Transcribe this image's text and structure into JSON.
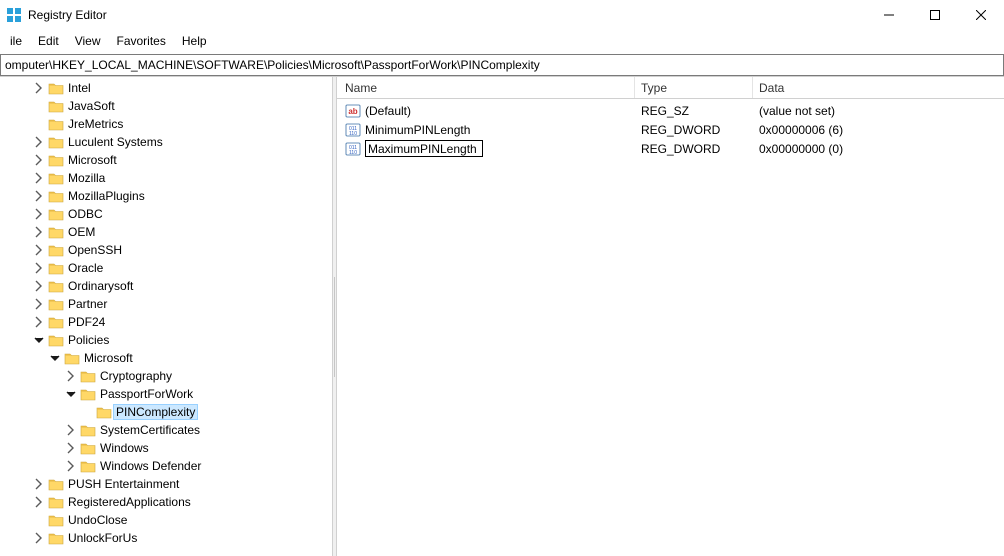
{
  "window": {
    "title": "Registry Editor"
  },
  "menu": {
    "file": "ile",
    "edit": "Edit",
    "view": "View",
    "favorites": "Favorites",
    "help": "Help"
  },
  "address": "omputer\\HKEY_LOCAL_MACHINE\\SOFTWARE\\Policies\\Microsoft\\PassportForWork\\PINComplexity",
  "columns": {
    "name": "Name",
    "type": "Type",
    "data": "Data"
  },
  "values": [
    {
      "icon": "string",
      "name": "(Default)",
      "type": "REG_SZ",
      "data": "(value not set)",
      "editing": false
    },
    {
      "icon": "binary",
      "name": "MinimumPINLength",
      "type": "REG_DWORD",
      "data": "0x00000006 (6)",
      "editing": false
    },
    {
      "icon": "binary",
      "name": "MaximumPINLength",
      "type": "REG_DWORD",
      "data": "0x00000000 (0)",
      "editing": true
    }
  ],
  "tree": [
    {
      "indent": 3,
      "exp": "closed",
      "label": "Intel"
    },
    {
      "indent": 3,
      "exp": "none",
      "label": "JavaSoft"
    },
    {
      "indent": 3,
      "exp": "none",
      "label": "JreMetrics"
    },
    {
      "indent": 3,
      "exp": "closed",
      "label": "Luculent Systems"
    },
    {
      "indent": 3,
      "exp": "closed",
      "label": "Microsoft"
    },
    {
      "indent": 3,
      "exp": "closed",
      "label": "Mozilla"
    },
    {
      "indent": 3,
      "exp": "closed",
      "label": "MozillaPlugins"
    },
    {
      "indent": 3,
      "exp": "closed",
      "label": "ODBC"
    },
    {
      "indent": 3,
      "exp": "closed",
      "label": "OEM"
    },
    {
      "indent": 3,
      "exp": "closed",
      "label": "OpenSSH"
    },
    {
      "indent": 3,
      "exp": "closed",
      "label": "Oracle"
    },
    {
      "indent": 3,
      "exp": "closed",
      "label": "Ordinarysoft"
    },
    {
      "indent": 3,
      "exp": "closed",
      "label": "Partner"
    },
    {
      "indent": 3,
      "exp": "closed",
      "label": "PDF24"
    },
    {
      "indent": 3,
      "exp": "open",
      "label": "Policies"
    },
    {
      "indent": 4,
      "exp": "open",
      "label": "Microsoft"
    },
    {
      "indent": 5,
      "exp": "closed",
      "label": "Cryptography"
    },
    {
      "indent": 5,
      "exp": "open",
      "label": "PassportForWork"
    },
    {
      "indent": 6,
      "exp": "none",
      "label": "PINComplexity",
      "selected": true
    },
    {
      "indent": 5,
      "exp": "closed",
      "label": "SystemCertificates"
    },
    {
      "indent": 5,
      "exp": "closed",
      "label": "Windows"
    },
    {
      "indent": 5,
      "exp": "closed",
      "label": "Windows Defender"
    },
    {
      "indent": 3,
      "exp": "closed",
      "label": "PUSH Entertainment"
    },
    {
      "indent": 3,
      "exp": "closed",
      "label": "RegisteredApplications"
    },
    {
      "indent": 3,
      "exp": "none",
      "label": "UndoClose"
    },
    {
      "indent": 3,
      "exp": "closed",
      "label": "UnlockForUs"
    }
  ]
}
